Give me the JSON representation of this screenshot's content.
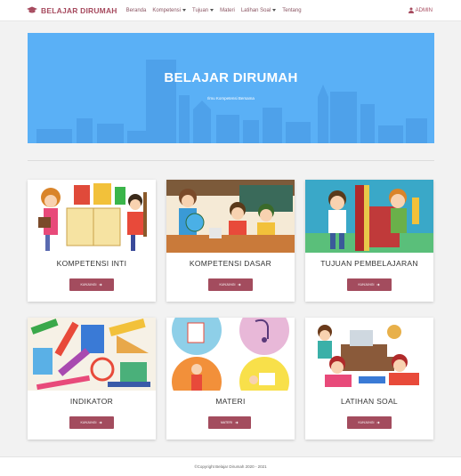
{
  "brand": {
    "name": "BELAJAR DIRUMAH",
    "color": "#a64a5e"
  },
  "nav": {
    "items": [
      {
        "label": "Beranda",
        "dropdown": false
      },
      {
        "label": "Kompetensi",
        "dropdown": true
      },
      {
        "label": "Tujuan",
        "dropdown": true
      },
      {
        "label": "Materi",
        "dropdown": false
      },
      {
        "label": "Latihan Soal",
        "dropdown": true
      },
      {
        "label": "Tentang",
        "dropdown": false
      }
    ],
    "user_label": "ADMIN"
  },
  "hero": {
    "title": "BELAJAR DIRUMAH",
    "subtitle": "Ilmu Kompetensi Bersama",
    "background": "#5ab0f6"
  },
  "cards": [
    {
      "title": "KOMPETENSI INTI",
      "button": "KUNJUNGI",
      "icon": "kids-reading-illustration"
    },
    {
      "title": "KOMPETENSI DASAR",
      "button": "KUNJUNGI",
      "icon": "classroom-globe-illustration"
    },
    {
      "title": "TUJUAN PEMBELAJARAN",
      "button": "KUNJUNGI",
      "icon": "kids-books-illustration"
    },
    {
      "title": "INDIKATOR",
      "button": "KUNJUNGI",
      "icon": "school-supplies-illustration"
    },
    {
      "title": "MATERI",
      "button": "MATERI",
      "icon": "subject-circles-illustration"
    },
    {
      "title": "LATIHAN SOAL",
      "button": "KUNJUNGI",
      "icon": "kids-studying-illustration"
    }
  ],
  "accent": "#a34c5e",
  "footer": {
    "text": "©Copyright Belajar Dirumah 2020 - 2021"
  }
}
